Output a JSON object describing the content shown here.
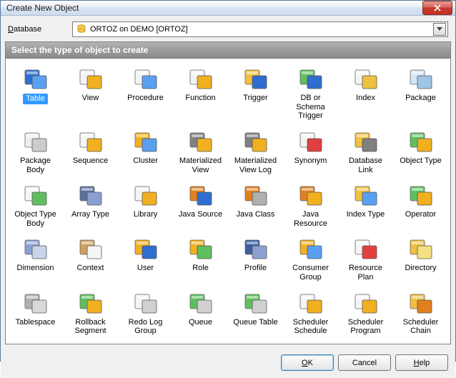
{
  "window": {
    "title": "Create New Object"
  },
  "database": {
    "label_pre": "D",
    "label_rest": "atabase",
    "selected": "ORTOZ on DEMO [ORTOZ]"
  },
  "section": {
    "header": "Select the type of object to create"
  },
  "objects": [
    {
      "id": "table",
      "label": "Table",
      "selected": true,
      "colors": [
        "#2f6dd0",
        "#5aa0f0"
      ]
    },
    {
      "id": "view",
      "label": "View",
      "colors": [
        "#f4f4f4",
        "#f0b020"
      ]
    },
    {
      "id": "procedure",
      "label": "Procedure",
      "colors": [
        "#f4f4f4",
        "#5aa0f0"
      ]
    },
    {
      "id": "function",
      "label": "Function",
      "colors": [
        "#f4f4f4",
        "#f0b020"
      ]
    },
    {
      "id": "trigger",
      "label": "Trigger",
      "colors": [
        "#f0c040",
        "#2f6dd0"
      ]
    },
    {
      "id": "db_schema_trigger",
      "label": "DB or Schema Trigger",
      "colors": [
        "#5fbf5f",
        "#2f6dd0"
      ]
    },
    {
      "id": "index",
      "label": "Index",
      "colors": [
        "#f4f4f4",
        "#f0c040"
      ]
    },
    {
      "id": "package",
      "label": "Package",
      "colors": [
        "#d5e6f7",
        "#9ec5e6"
      ]
    },
    {
      "id": "package_body",
      "label": "Package Body",
      "colors": [
        "#eeeeee",
        "#cccccc"
      ]
    },
    {
      "id": "sequence",
      "label": "Sequence",
      "colors": [
        "#f4f4f4",
        "#f0b020"
      ]
    },
    {
      "id": "cluster",
      "label": "Cluster",
      "colors": [
        "#f0b020",
        "#5aa0f0"
      ]
    },
    {
      "id": "materialized_view",
      "label": "Materialized View",
      "colors": [
        "#808080",
        "#f0b020"
      ]
    },
    {
      "id": "materialized_view_log",
      "label": "Materialized View Log",
      "colors": [
        "#808080",
        "#f0b020"
      ]
    },
    {
      "id": "synonym",
      "label": "Synonym",
      "colors": [
        "#f4f4f4",
        "#e04040"
      ]
    },
    {
      "id": "database_link",
      "label": "Database Link",
      "colors": [
        "#f0c040",
        "#808080"
      ]
    },
    {
      "id": "object_type",
      "label": "Object Type",
      "colors": [
        "#5fbf5f",
        "#f0b020"
      ]
    },
    {
      "id": "object_type_body",
      "label": "Object Type Body",
      "colors": [
        "#f4f4f4",
        "#5fbf5f"
      ]
    },
    {
      "id": "array_type",
      "label": "Array Type",
      "colors": [
        "#5a6f9f",
        "#8aa0d0"
      ]
    },
    {
      "id": "library",
      "label": "Library",
      "colors": [
        "#f4f4f4",
        "#f0b020"
      ]
    },
    {
      "id": "java_source",
      "label": "Java Source",
      "colors": [
        "#e08020",
        "#2f6dd0"
      ]
    },
    {
      "id": "java_class",
      "label": "Java Class",
      "colors": [
        "#e08020",
        "#b0b0b0"
      ]
    },
    {
      "id": "java_resource",
      "label": "Java Resource",
      "colors": [
        "#e08020",
        "#f0b020"
      ]
    },
    {
      "id": "index_type",
      "label": "Index Type",
      "colors": [
        "#f0c040",
        "#5aa0f0"
      ]
    },
    {
      "id": "operator",
      "label": "Operator",
      "colors": [
        "#5fbf5f",
        "#f0b020"
      ]
    },
    {
      "id": "dimension",
      "label": "Dimension",
      "colors": [
        "#8aa0d0",
        "#c8d4ea"
      ]
    },
    {
      "id": "context",
      "label": "Context",
      "colors": [
        "#d0a060",
        "#f4f4f4"
      ]
    },
    {
      "id": "user",
      "label": "User",
      "colors": [
        "#f0b020",
        "#2f6dd0"
      ]
    },
    {
      "id": "role",
      "label": "Role",
      "colors": [
        "#f0b020",
        "#5fbf5f"
      ]
    },
    {
      "id": "profile",
      "label": "Profile",
      "colors": [
        "#3a5f9f",
        "#8aa0d0"
      ]
    },
    {
      "id": "consumer_group",
      "label": "Consumer Group",
      "colors": [
        "#f0b020",
        "#5aa0f0"
      ]
    },
    {
      "id": "resource_plan",
      "label": "Resource Plan",
      "colors": [
        "#f4f4f4",
        "#e04040"
      ]
    },
    {
      "id": "directory",
      "label": "Directory",
      "colors": [
        "#f0c040",
        "#f4e080"
      ]
    },
    {
      "id": "tablespace",
      "label": "Tablespace",
      "colors": [
        "#b0b0b0",
        "#d8d8d8"
      ]
    },
    {
      "id": "rollback_segment",
      "label": "Rollback Segment",
      "colors": [
        "#5fbf5f",
        "#f0b020"
      ]
    },
    {
      "id": "redo_log_group",
      "label": "Redo Log Group",
      "colors": [
        "#f4f4f4",
        "#d0d0d0"
      ]
    },
    {
      "id": "queue",
      "label": "Queue",
      "colors": [
        "#5fbf5f",
        "#d0d0d0"
      ]
    },
    {
      "id": "queue_table",
      "label": "Queue Table",
      "colors": [
        "#5fbf5f",
        "#d0d0d0"
      ]
    },
    {
      "id": "scheduler_schedule",
      "label": "Scheduler Schedule",
      "colors": [
        "#f4f4f4",
        "#f0b020"
      ]
    },
    {
      "id": "scheduler_program",
      "label": "Scheduler Program",
      "colors": [
        "#f4f4f4",
        "#f0b020"
      ]
    },
    {
      "id": "scheduler_chain",
      "label": "Scheduler Chain",
      "colors": [
        "#f0c040",
        "#e08020"
      ]
    }
  ],
  "buttons": {
    "ok_pre": "O",
    "ok_rest": "K",
    "cancel": "Cancel",
    "help_pre": "H",
    "help_rest": "elp"
  }
}
